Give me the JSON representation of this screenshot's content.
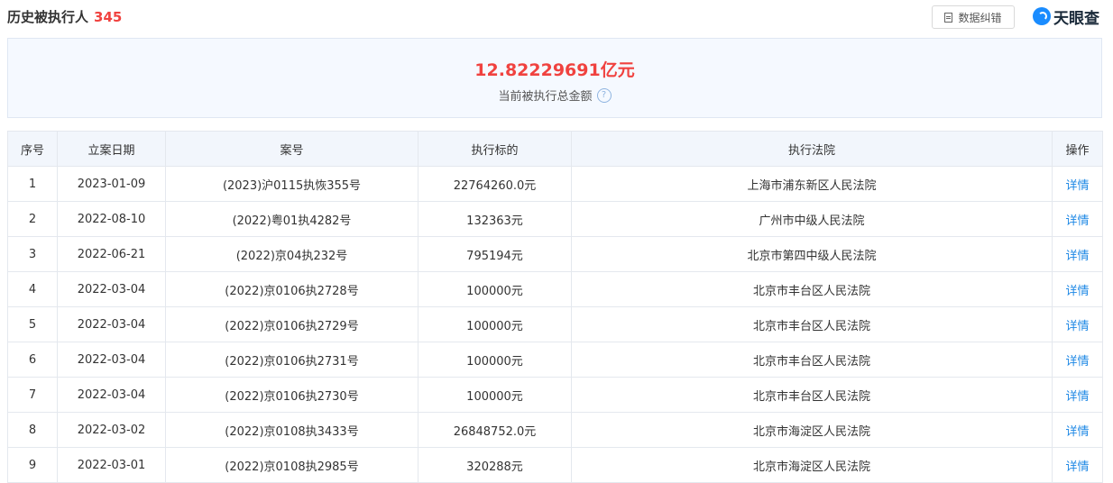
{
  "header": {
    "title": "历史被执行人",
    "count": "345",
    "error_button": "数据纠错",
    "logo_text": "天眼查"
  },
  "summary": {
    "amount": "12.82229691亿元",
    "label": "当前被执行总金额",
    "help_icon": "?"
  },
  "table": {
    "columns": [
      "序号",
      "立案日期",
      "案号",
      "执行标的",
      "执行法院",
      "操作"
    ],
    "rows": [
      {
        "no": "1",
        "date": "2023-01-09",
        "case": "(2023)沪0115执恢355号",
        "amount": "22764260.0元",
        "court": "上海市浦东新区人民法院",
        "action": "详情"
      },
      {
        "no": "2",
        "date": "2022-08-10",
        "case": "(2022)粤01执4282号",
        "amount": "132363元",
        "court": "广州市中级人民法院",
        "action": "详情"
      },
      {
        "no": "3",
        "date": "2022-06-21",
        "case": "(2022)京04执232号",
        "amount": "795194元",
        "court": "北京市第四中级人民法院",
        "action": "详情"
      },
      {
        "no": "4",
        "date": "2022-03-04",
        "case": "(2022)京0106执2728号",
        "amount": "100000元",
        "court": "北京市丰台区人民法院",
        "action": "详情"
      },
      {
        "no": "5",
        "date": "2022-03-04",
        "case": "(2022)京0106执2729号",
        "amount": "100000元",
        "court": "北京市丰台区人民法院",
        "action": "详情"
      },
      {
        "no": "6",
        "date": "2022-03-04",
        "case": "(2022)京0106执2731号",
        "amount": "100000元",
        "court": "北京市丰台区人民法院",
        "action": "详情"
      },
      {
        "no": "7",
        "date": "2022-03-04",
        "case": "(2022)京0106执2730号",
        "amount": "100000元",
        "court": "北京市丰台区人民法院",
        "action": "详情"
      },
      {
        "no": "8",
        "date": "2022-03-02",
        "case": "(2022)京0108执3433号",
        "amount": "26848752.0元",
        "court": "北京市海淀区人民法院",
        "action": "详情"
      },
      {
        "no": "9",
        "date": "2022-03-01",
        "case": "(2022)京0108执2985号",
        "amount": "320288元",
        "court": "北京市海淀区人民法院",
        "action": "详情"
      }
    ]
  }
}
